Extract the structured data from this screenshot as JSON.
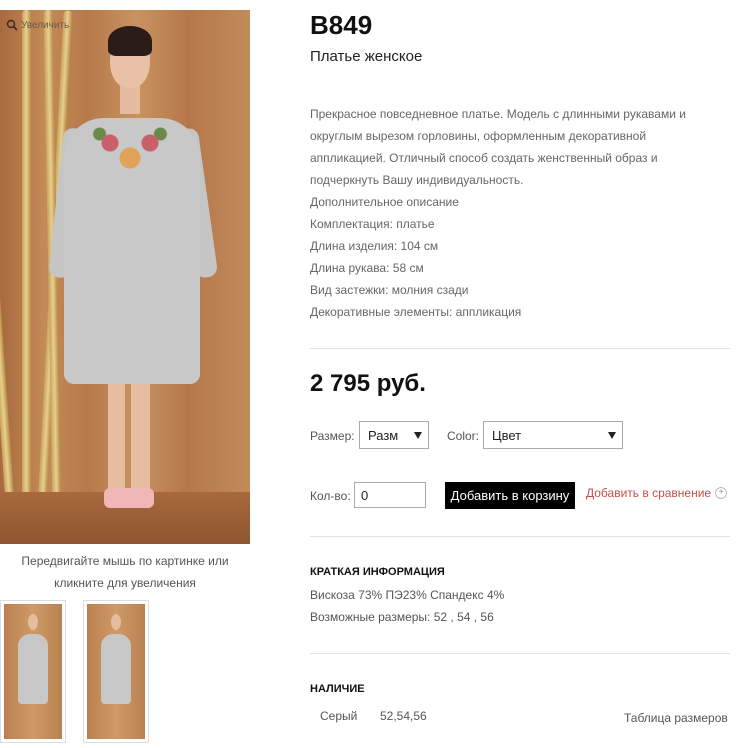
{
  "gallery": {
    "zoom_hint": "Увеличить",
    "caption": "Передвигайте мышь по картинке или кликните для увеличения"
  },
  "product": {
    "sku": "B849",
    "name": "Платье женское",
    "description": [
      "Прекрасное повседневное платье. Модель с длинными рукавами и",
      "округлым вырезом горловины, оформленным декоративной",
      "аппликацией. Отличный способ создать женственный образ и",
      "подчеркнуть Вашу индивидуальность.",
      "Дополнительное описание",
      "Комплектация: платье",
      "Длина изделия: 104 см",
      "Длина рукава: 58 см",
      "Вид застежки: молния сзади",
      "Декоративные элементы: аппликация"
    ],
    "price": "2 795 руб."
  },
  "options": {
    "size_label": "Размер:",
    "size_value": "Разм",
    "color_label": "Color:",
    "color_value": "Цвет",
    "qty_label": "Кол-во:",
    "qty_value": "0",
    "add_to_cart": "Добавить в корзину",
    "add_to_compare": "Добавить в сравнение"
  },
  "brief": {
    "title": "КРАТКАЯ ИНФОРМАЦИЯ",
    "composition": "Вискоза 73% ПЭ23% Спандекс 4%",
    "sizes": "Возможные размеры: 52 , 54 , 56"
  },
  "availability": {
    "title": "НАЛИЧИЕ",
    "color": "Серый",
    "sizes": "52,54,56",
    "size_table_link": "Таблица размеров"
  }
}
